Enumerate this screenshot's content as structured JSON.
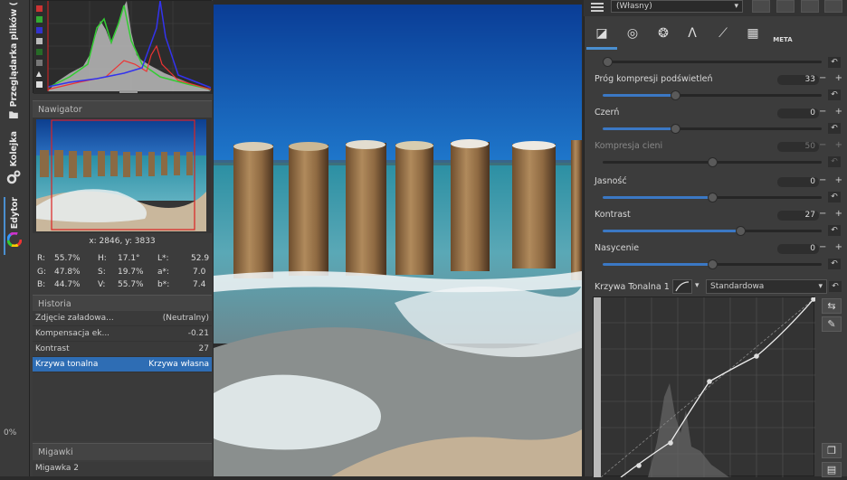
{
  "vertical_tabs": [
    {
      "label": "Przeglądarka plików (",
      "icon": "folder-icon"
    },
    {
      "label": "Kolejka",
      "icon": "gears-icon"
    },
    {
      "label": "Edytor",
      "icon": "color-wheel-icon",
      "active": true
    }
  ],
  "progress": "0%",
  "navigator": {
    "title": "Nawigator",
    "coords": "x: 2846, y: 3833"
  },
  "pixel_info": {
    "rgb": [
      {
        "k": "R:",
        "v": "55.7%"
      },
      {
        "k": "G:",
        "v": "47.8%"
      },
      {
        "k": "B:",
        "v": "44.7%"
      }
    ],
    "hsv": [
      {
        "k": "H:",
        "v": "17.1°"
      },
      {
        "k": "S:",
        "v": "19.7%"
      },
      {
        "k": "V:",
        "v": "55.7%"
      }
    ],
    "lab": [
      {
        "k": "L*:",
        "v": "52.9"
      },
      {
        "k": "a*:",
        "v": "7.0"
      },
      {
        "k": "b*:",
        "v": "7.4"
      }
    ]
  },
  "history": {
    "title": "Historia",
    "rows": [
      {
        "name": "Zdjęcie załadowa...",
        "value": "(Neutralny)"
      },
      {
        "name": "Kompensacja ek...",
        "value": "-0.21"
      },
      {
        "name": "Kontrast",
        "value": "27"
      },
      {
        "name": "Krzywa tonalna",
        "value": "Krzywa własna",
        "selected": true
      }
    ]
  },
  "snapshots": {
    "title": "Migawki",
    "rows": [
      "Migawka 2"
    ]
  },
  "profile": "(Własny)",
  "tool_tabs": [
    "exposure-icon",
    "detail-icon",
    "color-icon",
    "advanced-icon",
    "transform-icon",
    "raw-icon",
    "META"
  ],
  "sliders": [
    {
      "label": "Próg kompresji podświetleń",
      "value": "33",
      "frac": 0.33,
      "dim": false
    },
    {
      "label": "Czerń",
      "value": "0",
      "frac": 0.33,
      "dim": false
    },
    {
      "label": "Kompresja cieni",
      "value": "50",
      "frac": 0.5,
      "dim": true
    },
    {
      "label": "Jasność",
      "value": "0",
      "frac": 0.5,
      "dim": false
    },
    {
      "label": "Kontrast",
      "value": "27",
      "frac": 0.63,
      "dim": false
    },
    {
      "label": "Nasycenie",
      "value": "0",
      "frac": 0.5,
      "dim": false
    }
  ],
  "top_slider_frac": 0.0,
  "curve": {
    "label": "Krzywa Tonalna 1",
    "mode": "Standardowa"
  },
  "colors": {
    "accent": "#3b78c4",
    "selection": "#2e6db4"
  }
}
